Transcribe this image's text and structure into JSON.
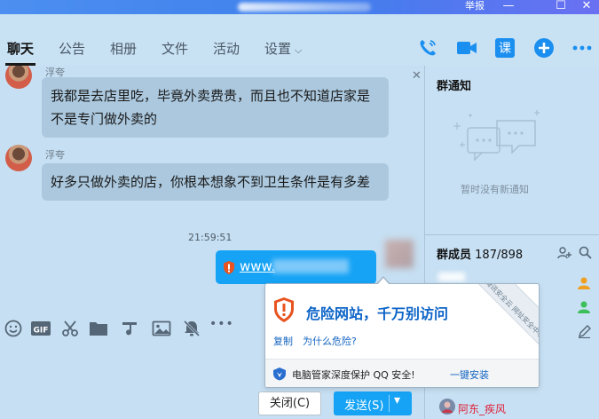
{
  "window": {
    "report_label": "举报",
    "minimize_glyph": "—",
    "maximize_glyph": "☐",
    "close_glyph": "✕"
  },
  "tabs": [
    {
      "label": "聊天",
      "active": true
    },
    {
      "label": "公告"
    },
    {
      "label": "相册"
    },
    {
      "label": "文件"
    },
    {
      "label": "活动"
    },
    {
      "label": "设置",
      "has_dropdown": true
    }
  ],
  "top_icons": [
    "phone-icon",
    "video-call-icon",
    "course-icon",
    "add-icon",
    "more-icon"
  ],
  "top_icon_labels": {
    "course": "课",
    "more": "•••"
  },
  "colors": {
    "accent": "#16a3f5",
    "titlebar": "#4c8ff0",
    "danger": "#e8531f",
    "member_name": "#e0203a"
  },
  "chat": {
    "close_glyph": "✕",
    "messages": [
      {
        "sender": "浮夸",
        "text": "我都是去店里吃，毕竟外卖费贵，而且也不知道店家是不是专门做外卖的"
      },
      {
        "sender": "浮夸",
        "text": "好多只做外卖的店，你根本想象不到卫生条件是有多差"
      }
    ],
    "timestamp": "21:59:51",
    "link_message": {
      "text": "www."
    }
  },
  "toolbar_icons": [
    "emoji-icon",
    "gif-icon",
    "scissors-icon",
    "folder-icon",
    "music-icon",
    "image-icon",
    "mute-bell-icon",
    "more-icon"
  ],
  "toolbar_labels": {
    "gif": "GIF",
    "more": "•••"
  },
  "popup": {
    "warning": "危险网站，千万别访问",
    "copy_link": "复制",
    "why_link": "为什么危险?",
    "footer_text": "电脑管家深度保护 QQ 安全!",
    "install_link": "一键安装",
    "ribbon": "腾讯安全云 网址安全中心"
  },
  "buttons": {
    "close": "关闭(C)",
    "send": "发送(S)",
    "send_caret": "▾"
  },
  "sidebar": {
    "notice_title": "群通知",
    "notice_empty": "暂时没有新通知",
    "members_label": "群成员",
    "members_count": "187/898",
    "visible_member": "阿东_疾风"
  }
}
